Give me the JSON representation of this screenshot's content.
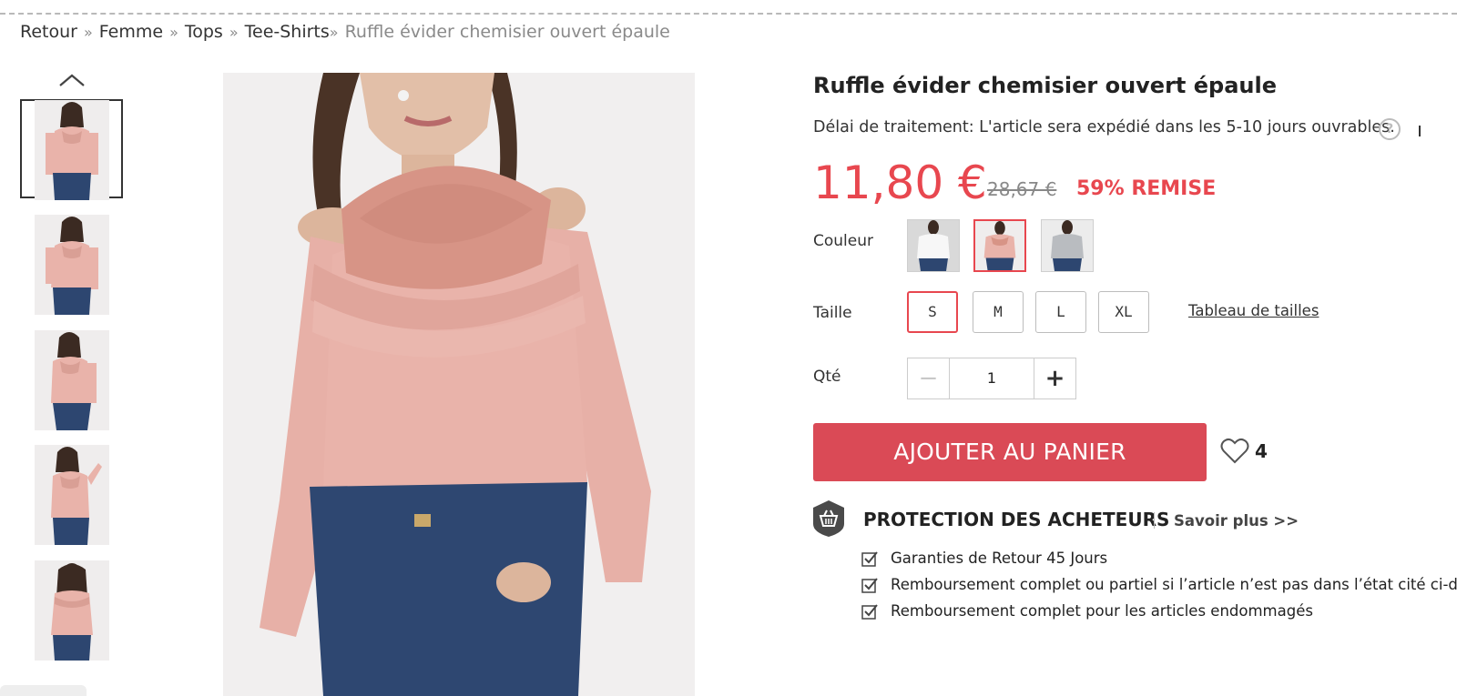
{
  "breadcrumb": {
    "items": [
      "Retour",
      "Femme",
      "Tops",
      "Tee-Shirts"
    ],
    "separator": "»",
    "current": "Ruffle évider chemisier ouvert épaule"
  },
  "gallery": {
    "up_icon": "chevron-up-icon",
    "thumbnails": [
      "thumb-front",
      "thumb-front-2",
      "thumb-side",
      "thumb-pose",
      "thumb-back"
    ],
    "active_index": 0
  },
  "product": {
    "title": "Ruffle évider chemisier ouvert épaule",
    "processing_text": "Délai de traitement: L'article sera expédié dans les 5-10 jours ouvrables.",
    "help_icon": "question-circle-icon",
    "price": "11,80 €",
    "old_price": "28,67 €",
    "discount": "59% REMISE",
    "price_color": "#e8474f"
  },
  "color": {
    "label": "Couleur",
    "options": [
      "white",
      "pink",
      "grey"
    ],
    "selected": "pink"
  },
  "size": {
    "label": "Taille",
    "options": [
      "S",
      "M",
      "L",
      "XL"
    ],
    "selected": "S",
    "chart_link": "Tableau de tailles"
  },
  "quantity": {
    "label": "Qté",
    "value": "1",
    "minus": "−",
    "plus": "+"
  },
  "cart": {
    "button_label": "AJOUTER AU PANIER",
    "button_color": "#da4a56",
    "wishlist_icon": "heart-outline-icon",
    "wishlist_count": "4"
  },
  "protection": {
    "icon": "shield-basket-icon",
    "title": "PROTECTION DES ACHETEURS",
    "learn_more": "Savoir plus >>",
    "guarantees": [
      "Garanties de Retour 45 Jours",
      "Remboursement complet ou partiel si l’article n’est pas dans l’état cité ci-dessus",
      "Remboursement complet pour les articles endommagés"
    ]
  }
}
